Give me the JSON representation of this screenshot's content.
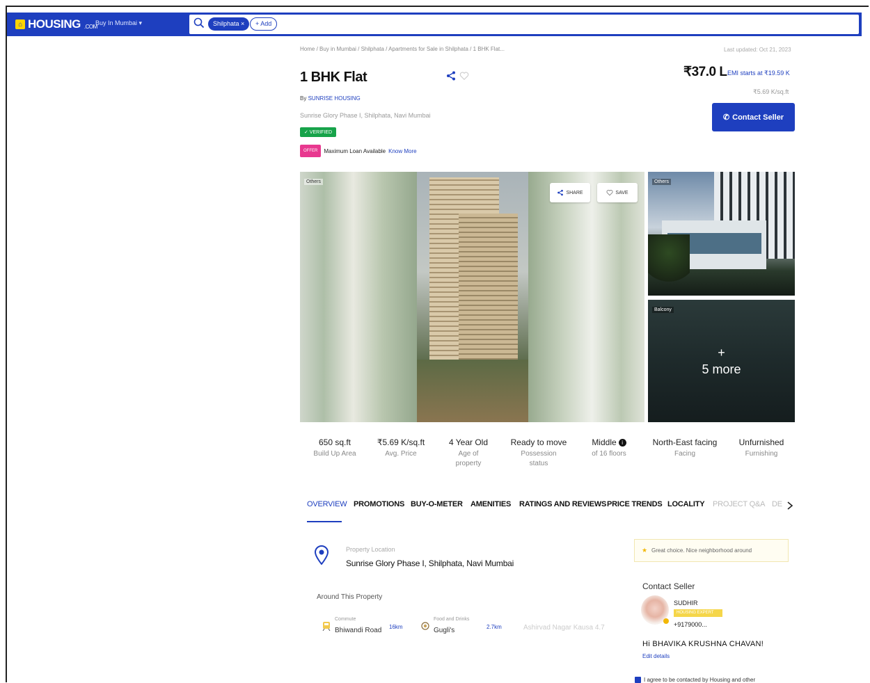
{
  "header": {
    "logo_text": "HOUSING",
    "logo_suffix": ".COM",
    "city_selector": "Buy In Mumbai",
    "search_chip": "Shilphata",
    "add_chip": "+ Add"
  },
  "listing": {
    "breadcrumb": "Home / Buy in Mumbai / Shilphata / Apartments for Sale in Shilphata / 1 BHK Flat...",
    "last_updated": "Last updated: Oct 21, 2023",
    "title": "1 BHK Flat",
    "builder_prefix": "By",
    "builder_name": "SUNRISE HOUSING",
    "address": "Sunrise Glory Phase I, Shilphata, Navi Mumbai",
    "verified": "✓ VERIFIED",
    "loan_tag": "OFFER",
    "loan_text": "Maximum Loan Available",
    "loan_link": "Know More",
    "price": "₹37.0 L",
    "emi": "EMI starts at ₹19.59 K",
    "price_per_sqft": "₹5.69 K/sq.ft",
    "contact_button": "Contact Seller"
  },
  "gallery": {
    "main_tag": "Others",
    "share_label": "SHARE",
    "save_label": "SAVE",
    "right_top_tag": "Others",
    "right_bottom_tag": "Balcony",
    "more_plus": "+",
    "more_label": "5 more"
  },
  "specs": [
    {
      "value": "650 sq.ft",
      "label": "Build Up Area"
    },
    {
      "value": "₹5.69 K/sq.ft",
      "label": "Avg. Price"
    },
    {
      "value": "4 Year Old",
      "label": "Age of property"
    },
    {
      "value": "Ready to move",
      "label": "Possession status"
    },
    {
      "value": "Middle",
      "label": "of 16 floors"
    },
    {
      "value": "North-East facing",
      "label": "Facing"
    },
    {
      "value": "Unfurnished",
      "label": "Furnishing"
    }
  ],
  "tabs": [
    "OVERVIEW",
    "PROMOTIONS",
    "BUY-O-METER",
    "AMENITIES",
    "RATINGS AND REVIEWS",
    "PRICE TRENDS",
    "LOCALITY",
    "PROJECT Q&A",
    "DE"
  ],
  "overview": {
    "location_label": "Property Location",
    "location_value": "Sunrise Glory Phase I, Shilphata, Navi Mumbai",
    "around_title": "Around This Property",
    "poi": [
      {
        "category": "Commute",
        "name": "Bhiwandi Road",
        "distance": "16km"
      },
      {
        "category": "Food and Drinks",
        "name": "Gugli's",
        "distance": "2.7km"
      }
    ],
    "poi_more": "Ashirvad Nagar Kausa 4.7"
  },
  "seller_panel": {
    "tip": "Great choice. Nice neighborhood around",
    "title": "Contact Seller",
    "seller_name": "SUDHIR",
    "seller_tag": "HOUSING EXPERT",
    "seller_phone": "+9179000...",
    "greeting": "Hi BHAVIKA KRUSHNA CHAVAN!",
    "edit_link": "Edit details",
    "agree_text": "I agree to be contacted by Housing and other"
  }
}
